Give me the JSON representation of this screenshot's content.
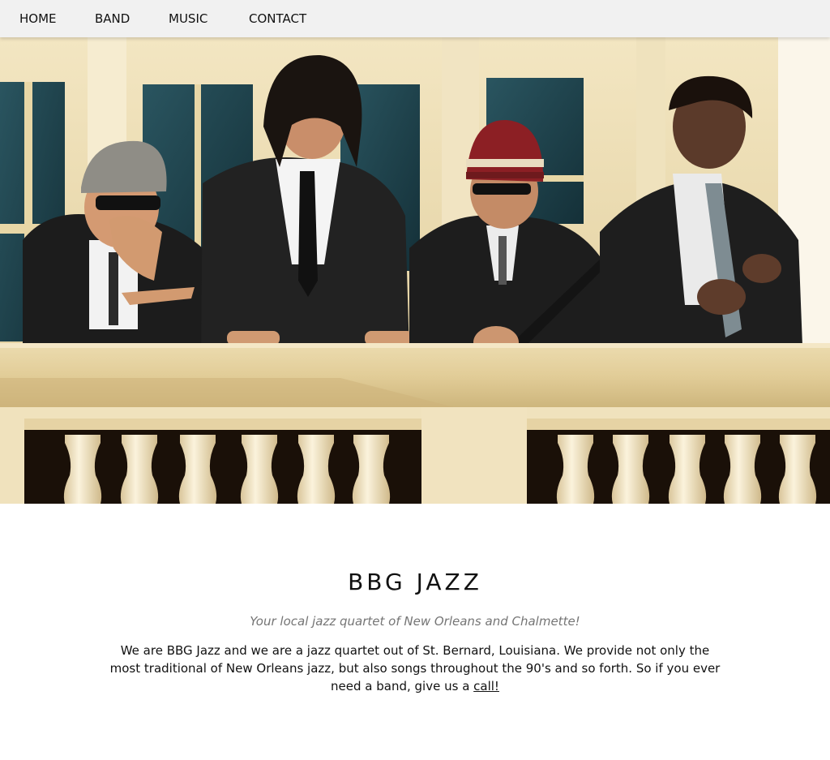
{
  "nav": {
    "items": [
      {
        "label": "HOME"
      },
      {
        "label": "BAND"
      },
      {
        "label": "MUSIC"
      },
      {
        "label": "CONTACT"
      }
    ]
  },
  "hero": {
    "image_icon": "band-photo-image"
  },
  "main": {
    "title": "BBG JAZZ",
    "tagline": "Your local jazz quartet of New Orleans and Chalmette!",
    "description_text": "We are BBG Jazz and we are a jazz quartet out of St. Bernard, Louisiana. We provide not only the most traditional of New Orleans jazz, but also songs throughout the 90's and so forth. So if you ever need a band, give us a ",
    "description_link": "call!"
  },
  "colors": {
    "navbar_bg": "#f1f1f1",
    "tagline": "#757575",
    "text": "#111111"
  }
}
